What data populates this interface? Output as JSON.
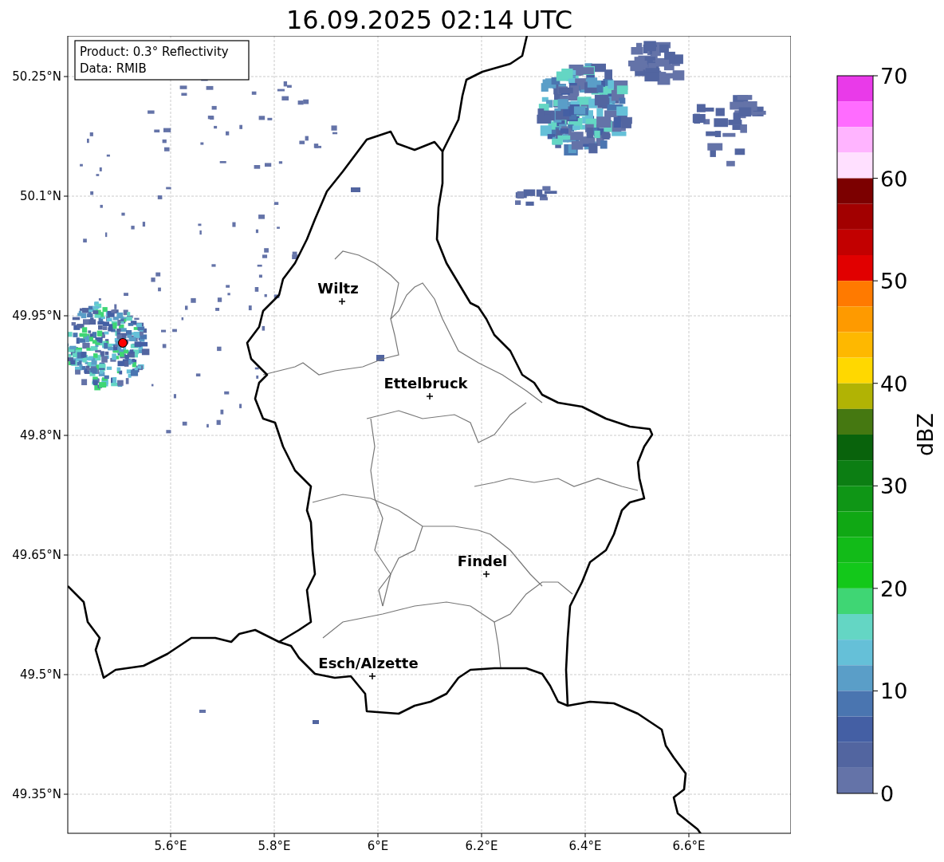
{
  "title": "16.09.2025 02:14 UTC",
  "info_box": [
    "Product: 0.3° Reflectivity",
    "Data: RMIB"
  ],
  "map": {
    "latitude_labels": [
      "50.25°N",
      "50.1°N",
      "49.95°N",
      "49.8°N",
      "49.65°N",
      "49.5°N",
      "49.35°N"
    ],
    "longitude_labels": [
      "5.6°E",
      "5.8°E",
      "6°E",
      "6.2°E",
      "6.4°E",
      "6.6°E"
    ],
    "places": [
      "Wiltz",
      "Ettelbruck",
      "Findel",
      "Esch/Alzette"
    ]
  },
  "colorbar": {
    "label": "dBZ",
    "ticks": [
      "70",
      "60",
      "50",
      "40",
      "30",
      "20",
      "10",
      "0"
    ],
    "bins": [
      {
        "color": "#e93ae9"
      },
      {
        "color": "#ff6cff"
      },
      {
        "color": "#ffb4ff"
      },
      {
        "color": "#ffe0ff"
      },
      {
        "color": "#7c0000"
      },
      {
        "color": "#a20000"
      },
      {
        "color": "#c20000"
      },
      {
        "color": "#e10000"
      },
      {
        "color": "#ff7a00"
      },
      {
        "color": "#fe9a00"
      },
      {
        "color": "#feb800"
      },
      {
        "color": "#ffd800"
      },
      {
        "color": "#b1b304"
      },
      {
        "color": "#457811"
      },
      {
        "color": "#09630c"
      },
      {
        "color": "#0c7e13"
      },
      {
        "color": "#0f9616"
      },
      {
        "color": "#10a814"
      },
      {
        "color": "#12bb18"
      },
      {
        "color": "#13c81a"
      },
      {
        "color": "#3fd674"
      },
      {
        "color": "#64d6c4"
      },
      {
        "color": "#65c0d8"
      },
      {
        "color": "#5a9ec8"
      },
      {
        "color": "#4a75b0"
      },
      {
        "color": "#445fa4"
      },
      {
        "color": "#5265a0"
      },
      {
        "color": "#6473a8"
      }
    ]
  }
}
